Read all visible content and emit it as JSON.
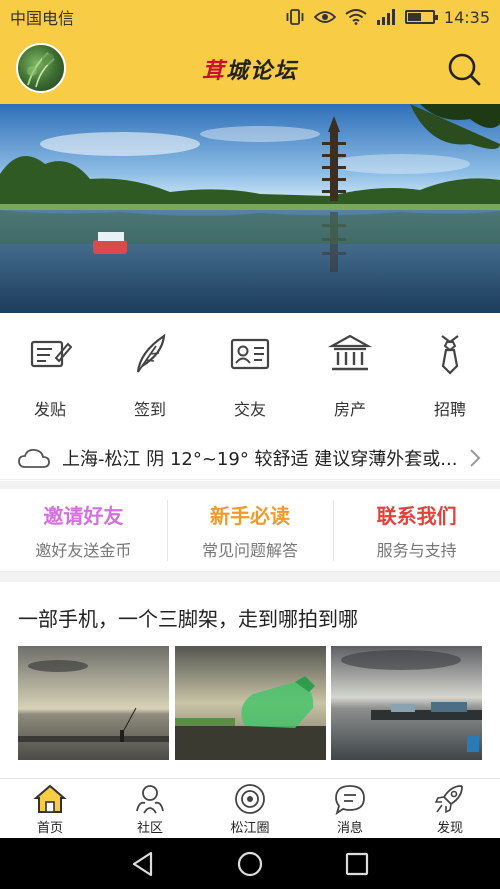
{
  "status_bar": {
    "carrier": "中国电信",
    "time": "14:35",
    "icons": [
      "vibrate-icon",
      "eye-icon",
      "wifi-icon",
      "signal-icon",
      "battery-icon"
    ]
  },
  "header": {
    "logo_first_char": "茸",
    "logo_rest": "城论坛",
    "avatar_icon": "avatar-image",
    "search_icon": "search-icon"
  },
  "banner": {
    "image": "pagoda-lake-photo"
  },
  "quick_actions": [
    {
      "label": "发贴",
      "icon": "post-icon"
    },
    {
      "label": "签到",
      "icon": "quill-icon"
    },
    {
      "label": "交友",
      "icon": "id-card-icon"
    },
    {
      "label": "房产",
      "icon": "bank-icon"
    },
    {
      "label": "招聘",
      "icon": "tie-icon"
    }
  ],
  "weather": {
    "text": "上海-松江 阴 12°~19° 较舒适 建议穿薄外套或...",
    "icon": "cloud-icon"
  },
  "cards": [
    {
      "title": "邀请好友",
      "subtitle": "邀好友送金币",
      "color": "#d66fe0"
    },
    {
      "title": "新手必读",
      "subtitle": "常见问题解答",
      "color": "#f09a2a"
    },
    {
      "title": "联系我们",
      "subtitle": "服务与支持",
      "color": "#e5413a"
    }
  ],
  "post": {
    "title": "一部手机，一个三脚架，走到哪拍到哪",
    "thumbnails": [
      "sunset-lake-photo",
      "glass-bottle-photo",
      "harbor-boats-photo"
    ]
  },
  "tabs": [
    {
      "label": "首页",
      "icon": "home-icon",
      "active": true
    },
    {
      "label": "社区",
      "icon": "community-icon"
    },
    {
      "label": "松江圈",
      "icon": "circle-icon"
    },
    {
      "label": "消息",
      "icon": "message-icon"
    },
    {
      "label": "发现",
      "icon": "rocket-icon"
    }
  ],
  "colors": {
    "accent": "#f8cc45",
    "home_icon_fill": "#f8cc45"
  }
}
